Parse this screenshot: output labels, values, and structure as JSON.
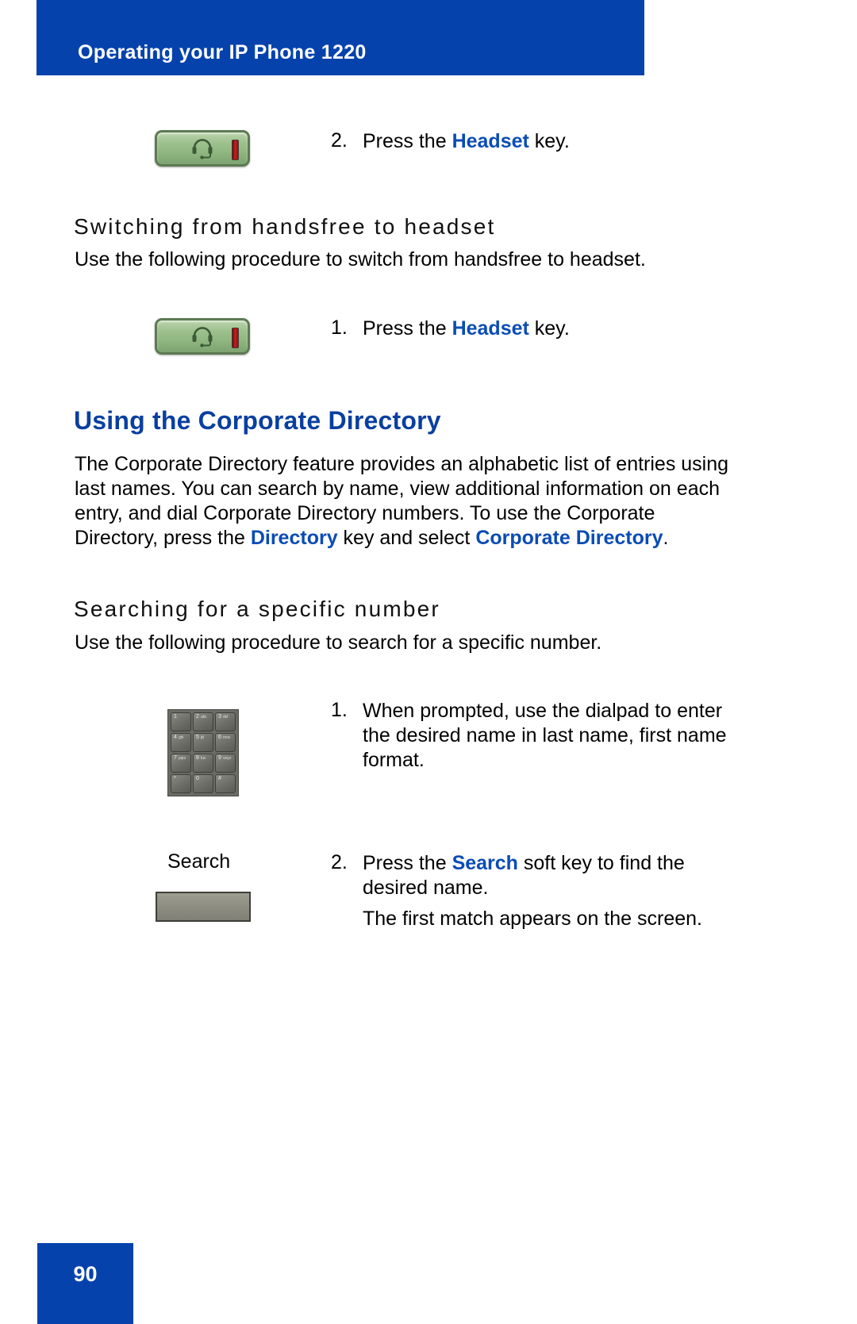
{
  "colors": {
    "brand_blue": "#0542ac",
    "heading_blue": "#0a3fa0",
    "emphasis_blue": "#0a4cb5",
    "key_green": "#9cc08c",
    "led_red": "#c41f1f",
    "dialpad_gray": "#6b6b66"
  },
  "header": {
    "title": "Operating your IP Phone 1220"
  },
  "sections": {
    "step_top": {
      "number": "2.",
      "text_before": "Press the ",
      "emphasis": "Headset",
      "text_after": " key.",
      "icon_name": "headset-key"
    },
    "switching": {
      "heading": "Switching from handsfree to headset",
      "intro": "Use the following procedure to switch from handsfree to headset.",
      "step": {
        "number": "1.",
        "text_before": "Press the ",
        "emphasis": "Headset",
        "text_after": " key.",
        "icon_name": "headset-key"
      }
    },
    "corporate_directory": {
      "heading": "Using the Corporate Directory",
      "paragraph_lines": [
        "The Corporate Directory feature provides an alphabetic list of entries",
        "using last names. You can search by name, view additional information",
        "on each entry, and dial Corporate Directory numbers. To use the",
        "Corporate Directory, press the ",
        " key and select ",
        "."
      ],
      "paragraph_emphasis": [
        "Directory",
        "Corporate",
        "Directory"
      ]
    },
    "searching": {
      "heading": "Searching for a specific number",
      "intro": "Use the following procedure to search for a specific number.",
      "steps": [
        {
          "number": "1.",
          "lines": [
            "When prompted, use the dialpad to enter",
            "the desired name in last name, first",
            "name format."
          ],
          "icon_name": "dialpad"
        },
        {
          "number": "2.",
          "text_before": "Press the ",
          "emphasis": "Search",
          "text_after": " soft key to find the",
          "line2": "desired name.",
          "line3": "The first match appears on the screen.",
          "softkey_label": "Search",
          "icon_name": "search-soft-key"
        }
      ]
    }
  },
  "dialpad_keys": [
    {
      "num": "1",
      "alpha": ""
    },
    {
      "num": "2",
      "alpha": "abc"
    },
    {
      "num": "3",
      "alpha": "def"
    },
    {
      "num": "4",
      "alpha": "ghi"
    },
    {
      "num": "5",
      "alpha": "jkl"
    },
    {
      "num": "6",
      "alpha": "mno"
    },
    {
      "num": "7",
      "alpha": "pqrs"
    },
    {
      "num": "8",
      "alpha": "tuv"
    },
    {
      "num": "9",
      "alpha": "wxyz"
    },
    {
      "num": "*",
      "alpha": ""
    },
    {
      "num": "0",
      "alpha": ""
    },
    {
      "num": "#",
      "alpha": ""
    }
  ],
  "footer": {
    "page_number": "90"
  }
}
